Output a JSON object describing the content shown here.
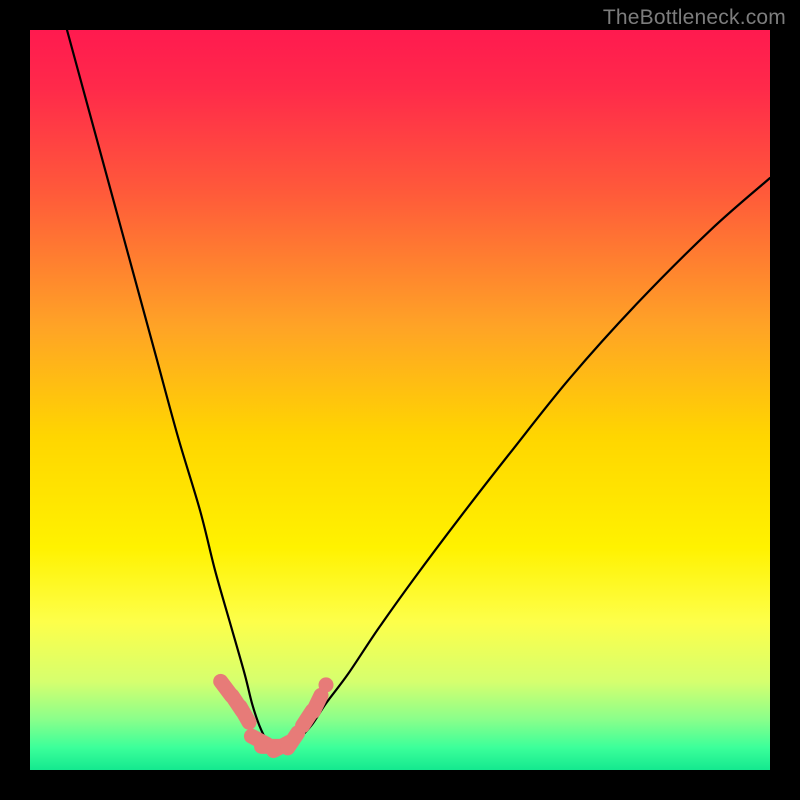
{
  "watermark": "TheBottleneck.com",
  "colors": {
    "frame": "#000000",
    "gradient_stops": [
      {
        "offset": 0.0,
        "color": "#ff1a4f"
      },
      {
        "offset": 0.08,
        "color": "#ff2a4a"
      },
      {
        "offset": 0.22,
        "color": "#ff5a3a"
      },
      {
        "offset": 0.4,
        "color": "#ffa326"
      },
      {
        "offset": 0.55,
        "color": "#ffd600"
      },
      {
        "offset": 0.7,
        "color": "#fff200"
      },
      {
        "offset": 0.8,
        "color": "#fdff4a"
      },
      {
        "offset": 0.88,
        "color": "#d6ff6e"
      },
      {
        "offset": 0.93,
        "color": "#8dff8a"
      },
      {
        "offset": 0.97,
        "color": "#3bff9a"
      },
      {
        "offset": 1.0,
        "color": "#14e98f"
      }
    ],
    "curve": "#000000",
    "marker_fill": "#e77b78",
    "marker_stroke": "#bd5755"
  },
  "chart_data": {
    "type": "line",
    "title": "",
    "xlabel": "",
    "ylabel": "",
    "xlim": [
      0,
      100
    ],
    "ylim": [
      0,
      100
    ],
    "note": "Axes are implicit/unlabeled. x is an unknown parameter ~0–100; y reads as a bottleneck percentage where 0 is at the bottom (green) and 100 at the top (red). Values estimated from pixel positions.",
    "series": [
      {
        "name": "bottleneck-curve",
        "x": [
          5,
          8,
          11,
          14,
          17,
          20,
          23,
          25,
          27,
          29,
          30,
          31,
          32,
          33,
          34,
          36,
          38,
          40,
          43,
          47,
          52,
          58,
          65,
          73,
          82,
          92,
          100
        ],
        "y": [
          100,
          89,
          78,
          67,
          56,
          45,
          35,
          27,
          20,
          13,
          9,
          6,
          4,
          3,
          3,
          4,
          6,
          9,
          13,
          19,
          26,
          34,
          43,
          53,
          63,
          73,
          80
        ]
      }
    ],
    "markers": {
      "name": "highlighted-points",
      "x": [
        26.5,
        28.0,
        29.0,
        31.0,
        32.5,
        34.0,
        35.5,
        37.5,
        38.8,
        40.0
      ],
      "y": [
        11.0,
        9.0,
        7.5,
        4.0,
        3.2,
        3.2,
        4.0,
        7.0,
        9.0,
        11.5
      ]
    }
  }
}
